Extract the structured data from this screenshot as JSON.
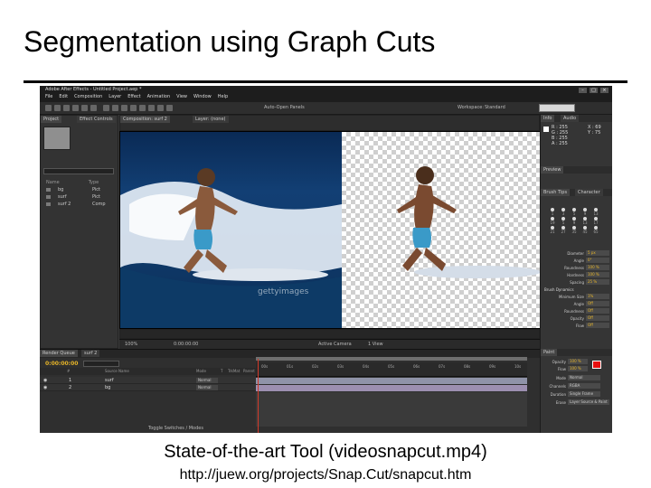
{
  "slide": {
    "title": "Segmentation using Graph Cuts",
    "caption": "State-of-the-art Tool (videosnapcut.mp4)",
    "link": "http://juew.org/projects/Snap.Cut/snapcut.htm"
  },
  "app": {
    "title": "Adobe After Effects - Untitled Project.aep *",
    "menu": [
      "File",
      "Edit",
      "Composition",
      "Layer",
      "Effect",
      "Animation",
      "View",
      "Window",
      "Help"
    ],
    "toolbar": {
      "brush_mode": "Auto-Open Panels",
      "workspace_label": "Workspace:",
      "workspace_value": "Standard"
    },
    "project_panel": {
      "tabs": [
        "Project",
        "Effect Controls"
      ],
      "column_name": "Name",
      "column_type": "Type",
      "items": [
        {
          "name": "bg",
          "type": "Pict"
        },
        {
          "name": "surf",
          "type": "Pict"
        },
        {
          "name": "surf 2",
          "type": "Comp"
        }
      ]
    },
    "viewer": {
      "tabs": [
        "Composition: surf 2",
        "Layer: (none)"
      ],
      "watermark": "gettyimages",
      "zoom": "100%",
      "timecode": "0:00:00:00",
      "camera": "Active Camera",
      "view": "1 View"
    },
    "timeline": {
      "tabs": [
        "Render Queue",
        "surf 2"
      ],
      "timecode": "0:00:00:00",
      "ruler": [
        "00s",
        "01s",
        "02s",
        "03s",
        "04s",
        "05s",
        "06s",
        "07s",
        "08s",
        "09s",
        "10s"
      ],
      "columns": [
        "#",
        "Source Name",
        "Mode",
        "T",
        "TrkMat",
        "Parent"
      ],
      "layers": [
        {
          "index": "1",
          "name": "surf",
          "mode": "Normal"
        },
        {
          "index": "2",
          "name": "bg",
          "mode": "Normal"
        }
      ],
      "toggle_label": "Toggle Switches / Modes"
    },
    "info_panel": {
      "tabs": [
        "Info",
        "Audio"
      ],
      "lines": [
        "R : 255",
        "G : 255",
        "B : 255",
        "A : 255"
      ],
      "coords": [
        "X : 69",
        "Y : 75"
      ]
    },
    "brush_panel": {
      "tabs": [
        "Preview",
        "Brush Tips",
        "Character"
      ],
      "sizes": [
        "1",
        "3",
        "5",
        "9",
        "13",
        "19",
        "5",
        "9",
        "13",
        "17",
        "21",
        "27",
        "35",
        "45",
        "65",
        "100"
      ],
      "props": [
        {
          "label": "Diameter",
          "value": "5 px"
        },
        {
          "label": "Angle",
          "value": "0°"
        },
        {
          "label": "Roundness",
          "value": "100 %"
        },
        {
          "label": "Hardness",
          "value": "100 %"
        },
        {
          "label": "Spacing",
          "value": "25 %"
        }
      ],
      "dynamics_label": "Brush Dynamics",
      "dynamics": [
        {
          "label": "Minimum Size",
          "value": "1%"
        },
        {
          "label": "Angle",
          "value": "Off"
        },
        {
          "label": "Roundness",
          "value": "Off"
        },
        {
          "label": "Opacity",
          "value": "Off"
        },
        {
          "label": "Flow",
          "value": "Off"
        }
      ]
    },
    "paint_panel": {
      "tab": "Paint",
      "props": [
        {
          "label": "Opacity",
          "value": "100 %"
        },
        {
          "label": "Flow",
          "value": "100 %"
        },
        {
          "label": "Mode",
          "value": "Normal"
        },
        {
          "label": "Channels",
          "value": "RGBA"
        },
        {
          "label": "Duration",
          "value": "Single Frame"
        },
        {
          "label": "Erase",
          "value": "Layer Source & Paint"
        }
      ],
      "foreground_color": "#e81010"
    }
  }
}
